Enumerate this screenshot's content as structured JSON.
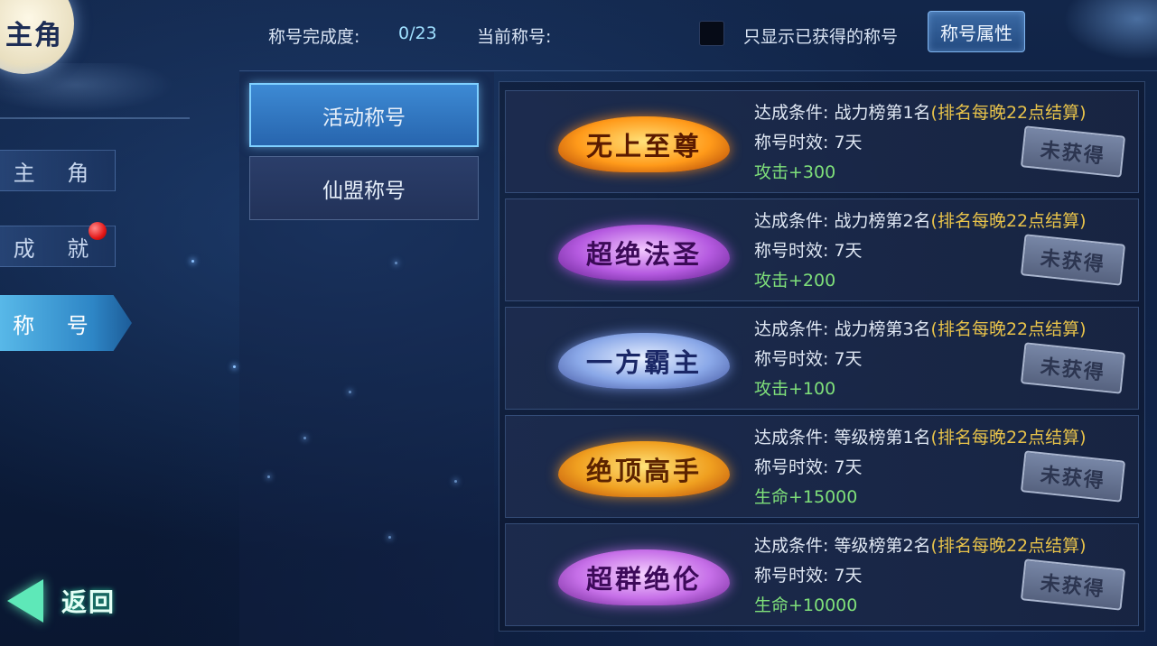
{
  "sidebar": {
    "emblem_label": "主角",
    "items": [
      {
        "label": "主 角"
      },
      {
        "label": "成 就"
      },
      {
        "label": "称 号"
      }
    ],
    "back_label": "返回"
  },
  "header": {
    "completion_label": "称号完成度:",
    "completion_value": "0/23",
    "current_title_label": "当前称号:",
    "filter_label": "只显示已获得的称号",
    "attributes_button": "称号属性"
  },
  "categories": [
    {
      "label": "活动称号"
    },
    {
      "label": "仙盟称号"
    }
  ],
  "titles": [
    {
      "name": "无上至尊",
      "condition": "达成条件: 战力榜第1名",
      "note": "(排名每晚22点结算)",
      "duration": "称号时效: 7天",
      "bonus": "攻击+300",
      "status": "未获得"
    },
    {
      "name": "超绝法圣",
      "condition": "达成条件: 战力榜第2名",
      "note": "(排名每晚22点结算)",
      "duration": "称号时效: 7天",
      "bonus": "攻击+200",
      "status": "未获得"
    },
    {
      "name": "一方霸主",
      "condition": "达成条件: 战力榜第3名",
      "note": "(排名每晚22点结算)",
      "duration": "称号时效: 7天",
      "bonus": "攻击+100",
      "status": "未获得"
    },
    {
      "name": "绝顶高手",
      "condition": "达成条件: 等级榜第1名",
      "note": "(排名每晚22点结算)",
      "duration": "称号时效: 7天",
      "bonus": "生命+15000",
      "status": "未获得"
    },
    {
      "name": "超群绝伦",
      "condition": "达成条件: 等级榜第2名",
      "note": "(排名每晚22点结算)",
      "duration": "称号时效: 7天",
      "bonus": "生命+10000",
      "status": "未获得"
    }
  ]
}
